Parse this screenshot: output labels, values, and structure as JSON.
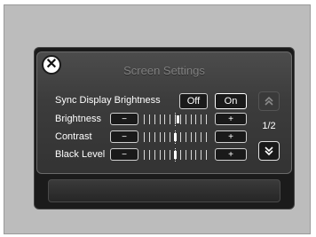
{
  "screen": {
    "title": "Screen Settings",
    "close_icon": "close-icon",
    "sync": {
      "label": "Sync Display Brightness",
      "off_label": "Off",
      "on_label": "On",
      "selected": "Off"
    },
    "rows": [
      {
        "label": "Brightness",
        "minus": "−",
        "plus": "+",
        "level": 0.55
      },
      {
        "label": "Contrast",
        "minus": "−",
        "plus": "+",
        "level": 0.5
      },
      {
        "label": "Black Level",
        "minus": "−",
        "plus": "+",
        "level": 0.5
      }
    ],
    "page_indicator": "1/2",
    "scroll_up_icon": "double-chevron-up-icon",
    "scroll_down_icon": "double-chevron-down-icon"
  }
}
